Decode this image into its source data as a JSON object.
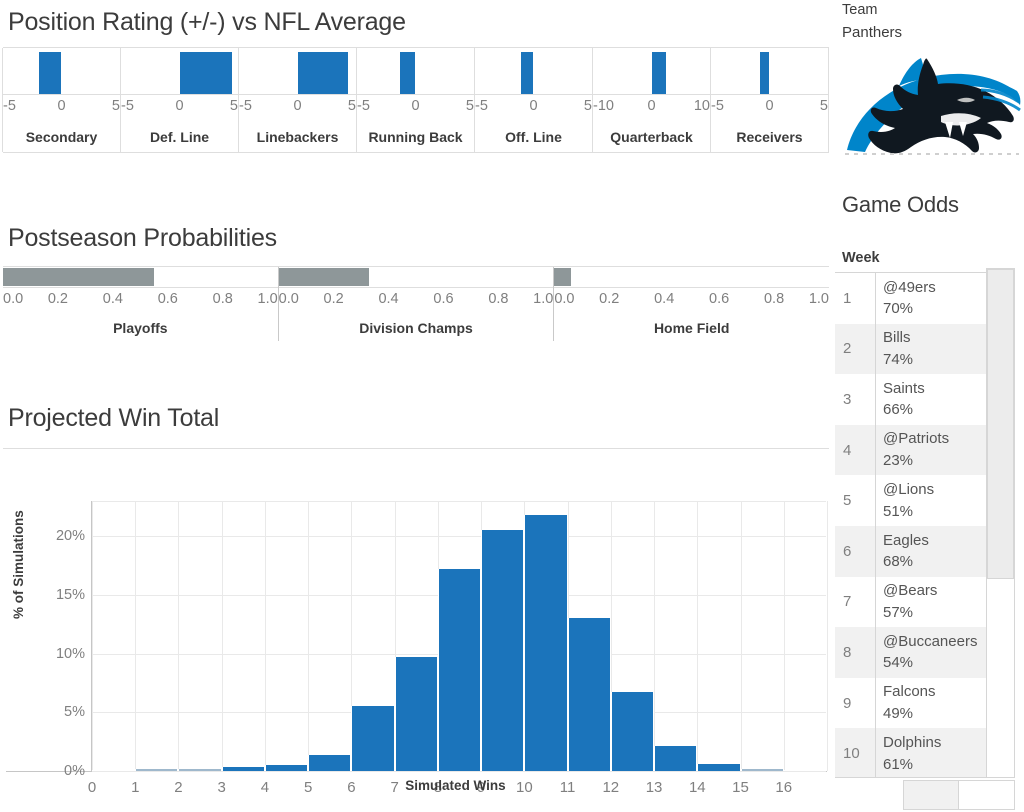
{
  "position_section": {
    "title": "Position Rating (+/-) vs NFL Average"
  },
  "postseason_section": {
    "title": "Postseason Probabilities"
  },
  "wintotal_section": {
    "title": "Projected Win Total"
  },
  "sidebar": {
    "team_label": "Team",
    "team_value": "Panthers",
    "logo_name": "panthers-logo",
    "odds_title": "Game Odds",
    "week_header": "Week",
    "rows": [
      {
        "week": "1",
        "opponent": "@49ers",
        "pct": "70%"
      },
      {
        "week": "2",
        "opponent": "Bills",
        "pct": "74%"
      },
      {
        "week": "3",
        "opponent": "Saints",
        "pct": "66%"
      },
      {
        "week": "4",
        "opponent": "@Patriots",
        "pct": "23%"
      },
      {
        "week": "5",
        "opponent": "@Lions",
        "pct": "51%"
      },
      {
        "week": "6",
        "opponent": "Eagles",
        "pct": "68%"
      },
      {
        "week": "7",
        "opponent": "@Bears",
        "pct": "57%"
      },
      {
        "week": "8",
        "opponent": "@Buccaneers",
        "pct": "54%"
      },
      {
        "week": "9",
        "opponent": "Falcons",
        "pct": "49%"
      },
      {
        "week": "10",
        "opponent": "Dolphins",
        "pct": "61%"
      }
    ]
  },
  "colors": {
    "bar_blue": "#1b74bb",
    "bar_gray": "#8e9799",
    "grid": "#e9e9e9",
    "text": "#3c3c3c",
    "tick_text": "#7f7f7f",
    "logo_blue": "#0085CA",
    "logo_black": "#101820",
    "logo_silver": "#BFC0BF"
  },
  "chart_data": [
    {
      "type": "bar",
      "id": "position-rating",
      "title": "Position Rating (+/-) vs NFL Average",
      "orientation": "horizontal-panels",
      "xlabel": "",
      "ylabel": "",
      "categories": [
        "Secondary",
        "Def. Line",
        "Linebackers",
        "Running Back",
        "Off. Line",
        "Quarterback",
        "Receivers"
      ],
      "values": [
        -1.9,
        4.5,
        4.3,
        -1.3,
        -1.1,
        2.4,
        -0.8
      ],
      "panel_axes": [
        {
          "ticks": [
            -5,
            0,
            5
          ],
          "xlim": [
            -5,
            5
          ]
        },
        {
          "ticks": [
            -5,
            0,
            5
          ],
          "xlim": [
            -5,
            5
          ]
        },
        {
          "ticks": [
            -5,
            0,
            5
          ],
          "xlim": [
            -5,
            5
          ]
        },
        {
          "ticks": [
            -5,
            0,
            5
          ],
          "xlim": [
            -5,
            5
          ]
        },
        {
          "ticks": [
            -5,
            0,
            5
          ],
          "xlim": [
            -5,
            5
          ]
        },
        {
          "ticks": [
            -10,
            0,
            10
          ],
          "xlim": [
            -10,
            10
          ]
        },
        {
          "ticks": [
            -5,
            0,
            5
          ],
          "xlim": [
            -5,
            5
          ]
        }
      ],
      "tick_labels": [
        [
          "-5",
          "0",
          "5"
        ],
        [
          "-5",
          "0",
          "5"
        ],
        [
          "-5",
          "0",
          "5"
        ],
        [
          "-5",
          "0",
          "5"
        ],
        [
          "-5",
          "0",
          "5"
        ],
        [
          "-10",
          "0",
          "10"
        ],
        [
          "-5",
          "0",
          "5"
        ]
      ],
      "grid": false,
      "legend": "none"
    },
    {
      "type": "bar",
      "id": "postseason-probabilities",
      "title": "Postseason Probabilities",
      "orientation": "horizontal-panels",
      "categories": [
        "Playoffs",
        "Division Champs",
        "Home Field"
      ],
      "values": [
        0.55,
        0.33,
        0.06
      ],
      "xlim": [
        0,
        1
      ],
      "tick_values": [
        0.0,
        0.2,
        0.4,
        0.6,
        0.8,
        1.0
      ],
      "tick_labels": [
        "0.0",
        "0.2",
        "0.4",
        "0.6",
        "0.8",
        "1.0"
      ],
      "grid": false,
      "legend": "none"
    },
    {
      "type": "bar",
      "id": "projected-win-total",
      "title": "Projected Win Total",
      "xlabel": "Simulated Wins",
      "ylabel": "% of Simulations",
      "categories": [
        "0",
        "1",
        "2",
        "3",
        "4",
        "5",
        "6",
        "7",
        "8",
        "9",
        "10",
        "11",
        "12",
        "13",
        "14",
        "15",
        "16"
      ],
      "values": [
        0.0,
        0.05,
        0.05,
        0.3,
        0.5,
        1.4,
        5.5,
        9.7,
        17.2,
        20.5,
        21.8,
        13.0,
        6.7,
        2.1,
        0.6,
        0.1,
        0.0
      ],
      "ylim": [
        0,
        23
      ],
      "ytick_values": [
        0,
        5,
        10,
        15,
        20
      ],
      "ytick_labels": [
        "0%",
        "5%",
        "10%",
        "15%",
        "20%"
      ],
      "xtick_labels": [
        "0",
        "1",
        "2",
        "3",
        "4",
        "5",
        "6",
        "7",
        "8",
        "9",
        "10",
        "11",
        "12",
        "13",
        "14",
        "15",
        "16"
      ],
      "grid": true,
      "legend": "none"
    }
  ]
}
